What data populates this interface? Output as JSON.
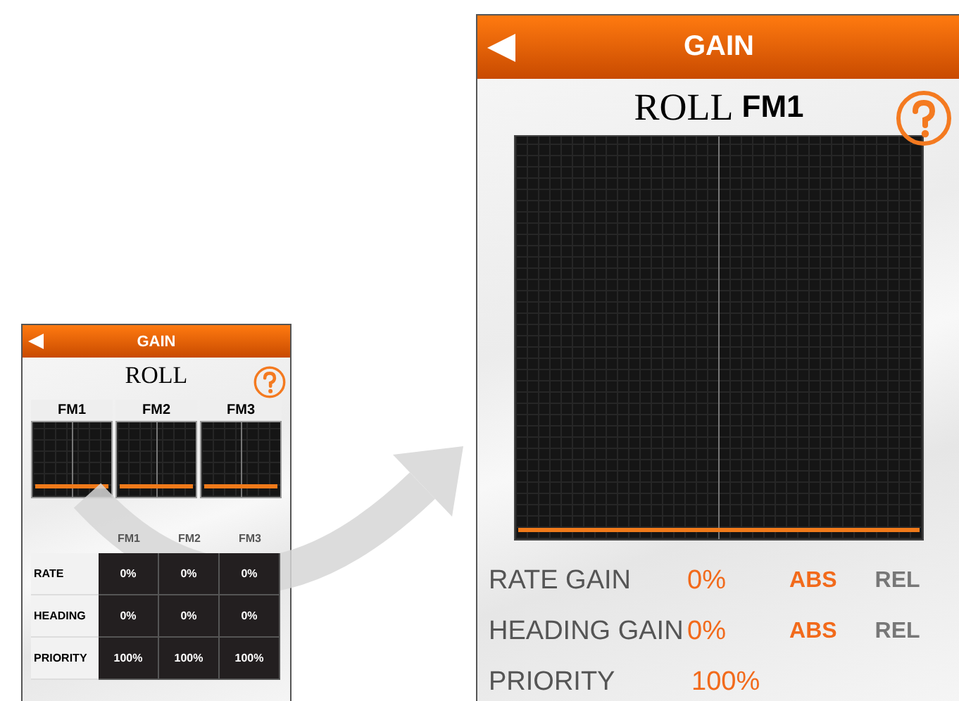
{
  "left_screen": {
    "header": {
      "title": "GAIN"
    },
    "heading": "ROLL",
    "flight_modes": [
      {
        "label": "FM1"
      },
      {
        "label": "FM2"
      },
      {
        "label": "FM3"
      }
    ],
    "table": {
      "columns": [
        "FM1",
        "FM2",
        "FM3"
      ],
      "rows": [
        {
          "label": "RATE",
          "cells": [
            "0%",
            "0%",
            "0%"
          ]
        },
        {
          "label": "HEADING",
          "cells": [
            "0%",
            "0%",
            "0%"
          ]
        },
        {
          "label": "PRIORITY",
          "cells": [
            "100%",
            "100%",
            "100%"
          ]
        }
      ]
    }
  },
  "right_screen": {
    "header": {
      "title": "GAIN"
    },
    "heading": "ROLL",
    "mode": "FM1",
    "settings": [
      {
        "label": "RATE GAIN",
        "value": "0%",
        "options": [
          {
            "label": "ABS",
            "selected": true
          },
          {
            "label": "REL",
            "selected": false
          }
        ]
      },
      {
        "label": "HEADING GAIN",
        "value": "0%",
        "options": [
          {
            "label": "ABS",
            "selected": true
          },
          {
            "label": "REL",
            "selected": false
          }
        ]
      },
      {
        "label": "PRIORITY",
        "value": "100%"
      }
    ]
  }
}
